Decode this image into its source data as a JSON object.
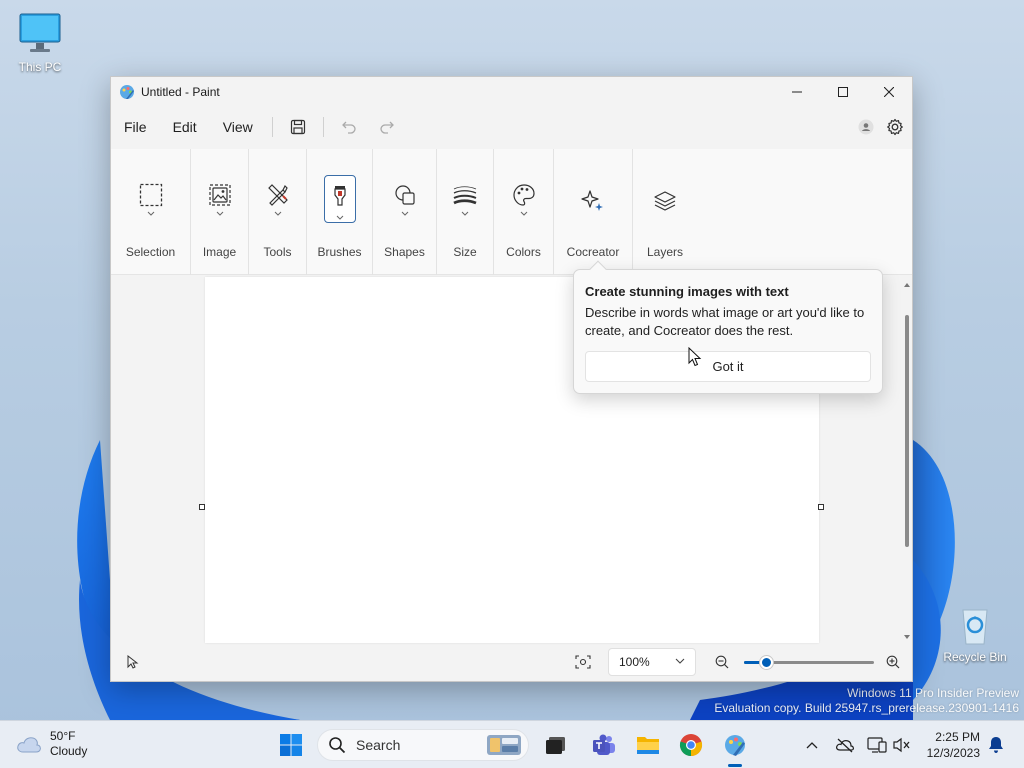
{
  "desktop": {
    "icons": [
      {
        "label": "This PC"
      },
      {
        "label": "Recycle Bin"
      }
    ],
    "watermark": {
      "line1": "Windows 11 Pro Insider Preview",
      "line2": "Evaluation copy. Build 25947.rs_prerelease.230901-1416"
    }
  },
  "window": {
    "title": "Untitled - Paint",
    "menu": [
      "File",
      "Edit",
      "View"
    ],
    "ribbon": [
      {
        "label": "Selection",
        "icon": "selection-icon"
      },
      {
        "label": "Image",
        "icon": "image-icon"
      },
      {
        "label": "Tools",
        "icon": "tools-icon"
      },
      {
        "label": "Brushes",
        "icon": "brush-icon"
      },
      {
        "label": "Shapes",
        "icon": "shapes-icon"
      },
      {
        "label": "Size",
        "icon": "size-icon"
      },
      {
        "label": "Colors",
        "icon": "palette-icon"
      },
      {
        "label": "Cocreator",
        "icon": "sparkle-icon"
      },
      {
        "label": "Layers",
        "icon": "layers-icon"
      }
    ],
    "status": {
      "zoom": "100%",
      "zoom_slider_fraction": 0.17
    }
  },
  "tip": {
    "title": "Create stunning images with text",
    "body": "Describe in words what image or art you'd like to create, and Cocreator does the rest.",
    "button": "Got it"
  },
  "taskbar": {
    "weather_temp": "50°F",
    "weather_cond": "Cloudy",
    "search_placeholder": "Search",
    "time": "2:25 PM",
    "date": "12/3/2023"
  },
  "colors": {
    "accent": "#005fb8",
    "window_bg": "#f3f3f3",
    "ribbon_bg": "#f9f9f9"
  }
}
